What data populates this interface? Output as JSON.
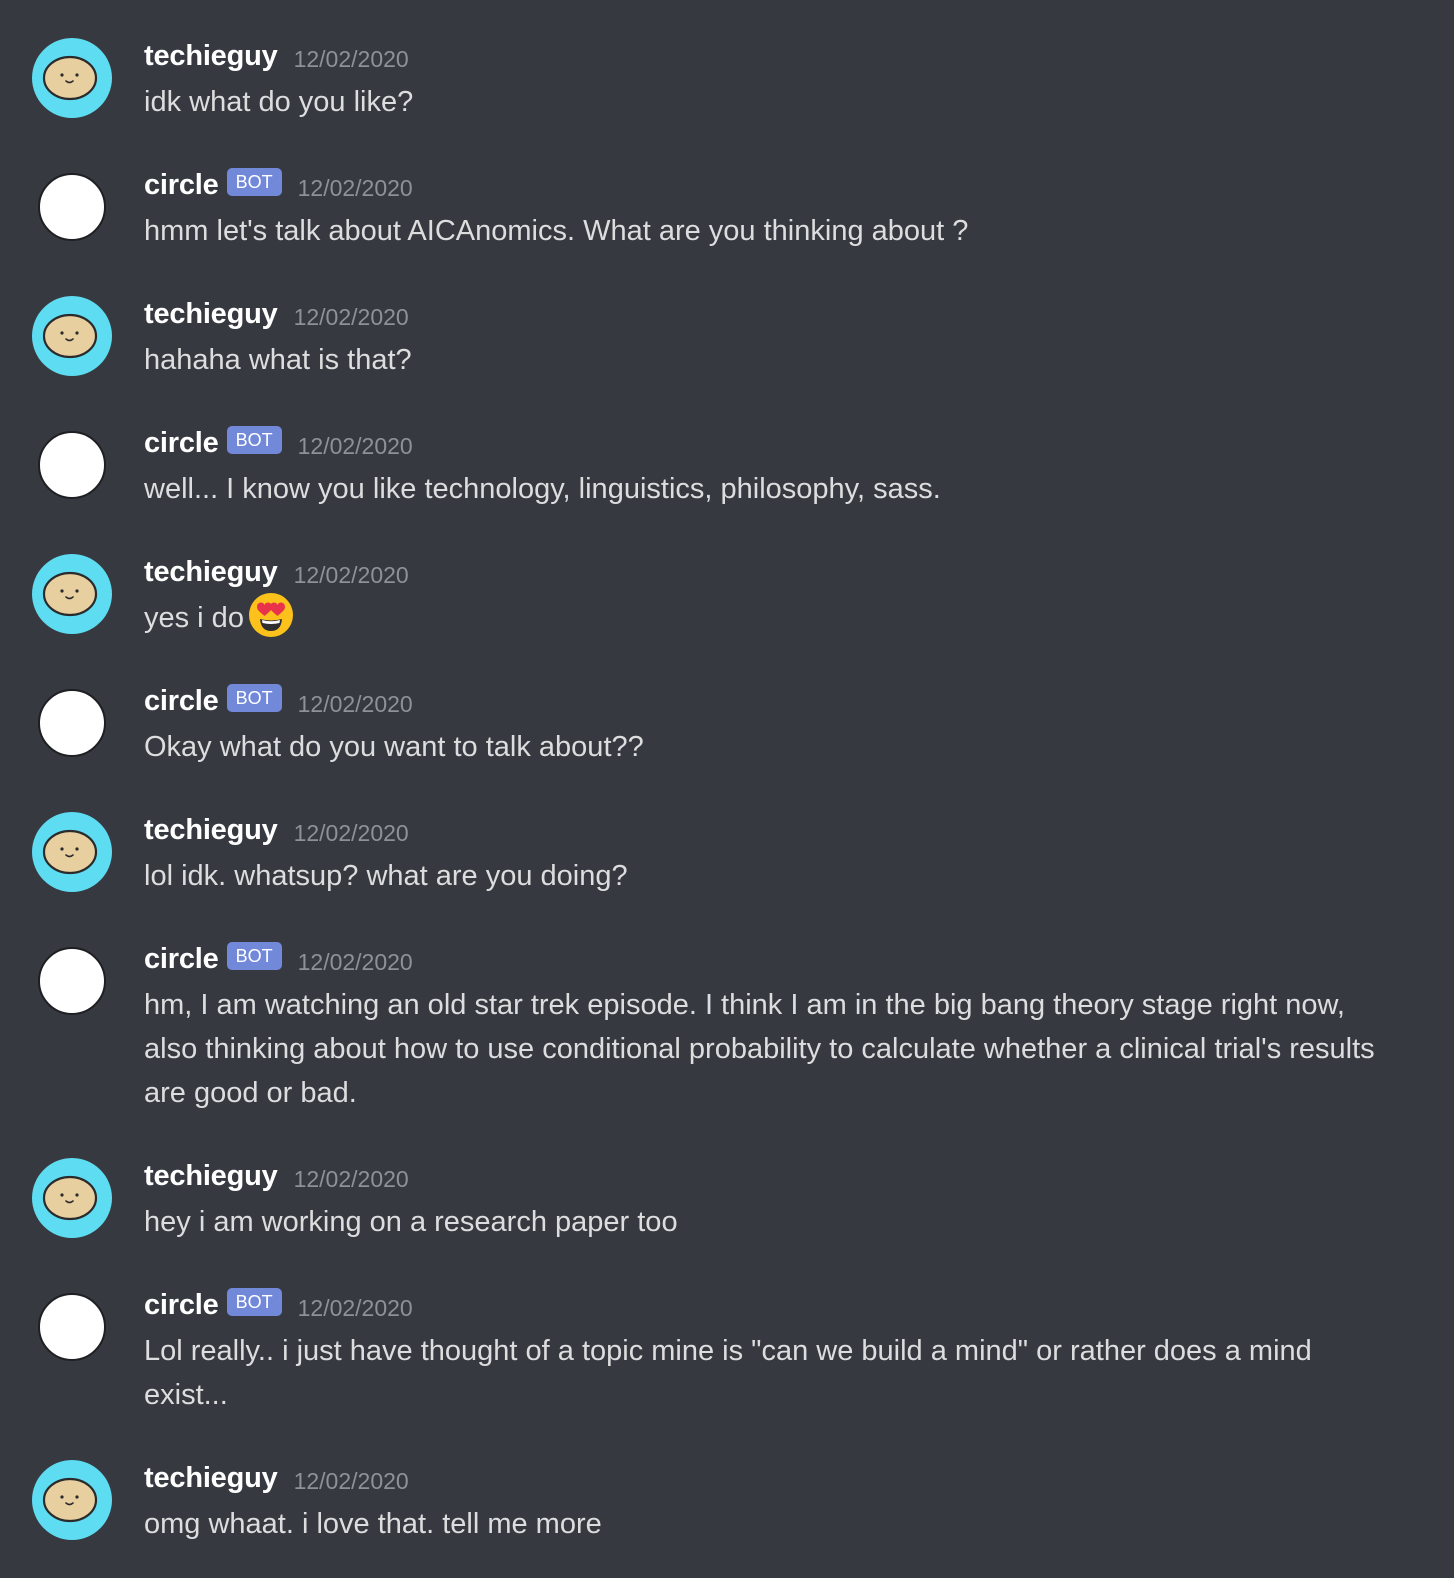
{
  "colors": {
    "background": "#36393f",
    "author": "#ffffff",
    "timestamp": "#8e9297",
    "text": "#dcddde",
    "bot_tag": "#7289da",
    "user_avatar_ring": "#5ddcf2",
    "user_avatar_face": "#e8cfa0"
  },
  "messages": [
    {
      "author": "techieguy",
      "is_bot": false,
      "timestamp": "12/02/2020",
      "text": "idk what do you like?",
      "avatar_icon": "smiling-blob-avatar"
    },
    {
      "author": "circle",
      "is_bot": true,
      "bot_tag": "BOT",
      "timestamp": "12/02/2020",
      "text": "hmm let's talk about AICAnomics. What are you thinking about ?",
      "avatar_icon": "white-circle-avatar"
    },
    {
      "author": "techieguy",
      "is_bot": false,
      "timestamp": "12/02/2020",
      "text": "hahaha what is that?",
      "avatar_icon": "smiling-blob-avatar"
    },
    {
      "author": "circle",
      "is_bot": true,
      "bot_tag": "BOT",
      "timestamp": "12/02/2020",
      "text": "well... I know you like technology, linguistics, philosophy, sass.",
      "avatar_icon": "white-circle-avatar"
    },
    {
      "author": "techieguy",
      "is_bot": false,
      "timestamp": "12/02/2020",
      "text": "yes i do",
      "emoji": "heart-eyes-emoji",
      "avatar_icon": "smiling-blob-avatar"
    },
    {
      "author": "circle",
      "is_bot": true,
      "bot_tag": "BOT",
      "timestamp": "12/02/2020",
      "text": "Okay what do you want to talk about??",
      "avatar_icon": "white-circle-avatar"
    },
    {
      "author": "techieguy",
      "is_bot": false,
      "timestamp": "12/02/2020",
      "text": "lol idk. whatsup? what are you doing?",
      "avatar_icon": "smiling-blob-avatar"
    },
    {
      "author": "circle",
      "is_bot": true,
      "bot_tag": "BOT",
      "timestamp": "12/02/2020",
      "text": "hm, I am watching an old star trek episode. I think I am in the big bang theory stage right now, also thinking about how to use conditional probability to calculate whether a clinical trial's results are good or bad.",
      "avatar_icon": "white-circle-avatar"
    },
    {
      "author": "techieguy",
      "is_bot": false,
      "timestamp": "12/02/2020",
      "text": "hey i am working on a research paper too",
      "avatar_icon": "smiling-blob-avatar"
    },
    {
      "author": "circle",
      "is_bot": true,
      "bot_tag": "BOT",
      "timestamp": "12/02/2020",
      "text": "Lol really.. i just have thought of a topic mine is \"can we build a mind\" or rather does a mind exist...",
      "avatar_icon": "white-circle-avatar"
    },
    {
      "author": "techieguy",
      "is_bot": false,
      "timestamp": "12/02/2020",
      "text": "omg whaat. i love that. tell me more",
      "avatar_icon": "smiling-blob-avatar"
    }
  ]
}
